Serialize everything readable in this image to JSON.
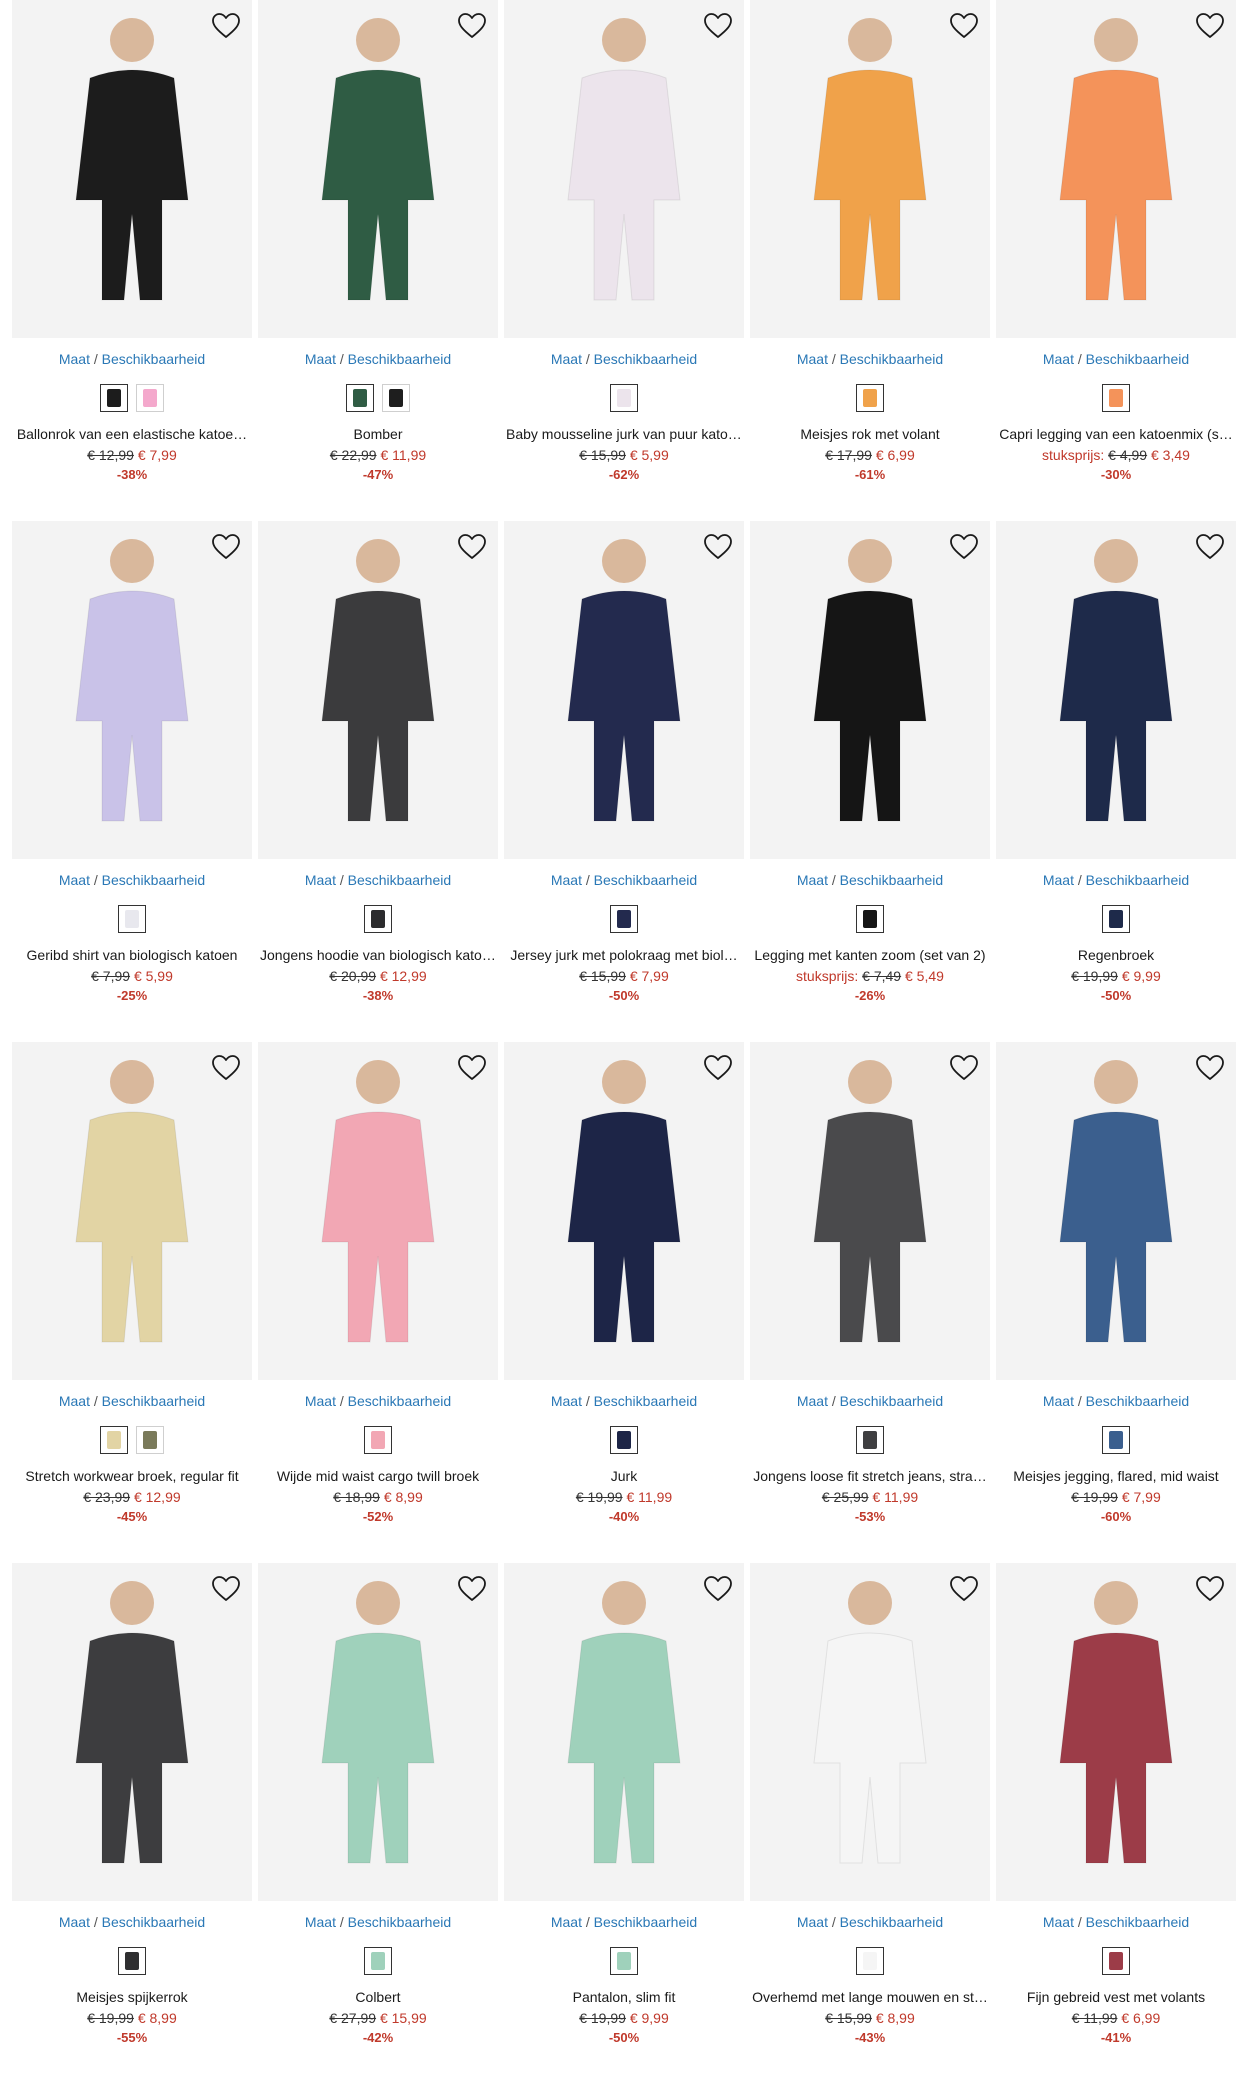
{
  "labels": {
    "size_link_a": "Maat",
    "size_link_sep": " / ",
    "size_link_b": "Beschikbaarheid"
  },
  "colors": {
    "link": "#2a78b6",
    "sale": "#c0392b",
    "image_bg": "#f3f3f3"
  },
  "products": [
    {
      "title": "Ballonrok van een elastische katoe…",
      "old_price": "€ 12,99",
      "new_price": "€ 7,99",
      "discount": "-38%",
      "unit_label": "",
      "main_color": "#1c1c1c",
      "swatches": [
        "#1c1c1c",
        "#f4a8cc"
      ]
    },
    {
      "title": "Bomber",
      "old_price": "€ 22,99",
      "new_price": "€ 11,99",
      "discount": "-47%",
      "unit_label": "",
      "main_color": "#2f5c44",
      "swatches": [
        "#2f5c44",
        "#1e1e1e"
      ]
    },
    {
      "title": "Baby mousseline jurk van puur katoen",
      "old_price": "€ 15,99",
      "new_price": "€ 5,99",
      "discount": "-62%",
      "unit_label": "",
      "main_color": "#ece4ec",
      "swatches": [
        "#ece4ec"
      ]
    },
    {
      "title": "Meisjes rok met volant",
      "old_price": "€ 17,99",
      "new_price": "€ 6,99",
      "discount": "-61%",
      "unit_label": "",
      "main_color": "#f0a24a",
      "swatches": [
        "#f0a24a"
      ]
    },
    {
      "title": "Capri legging van een katoenmix (s…",
      "old_price": "€ 4,99",
      "new_price": "€ 3,49",
      "discount": "-30%",
      "unit_label": "stuksprijs:",
      "main_color": "#f4935a",
      "swatches": [
        "#f4935a"
      ]
    },
    {
      "title": "Geribd shirt van biologisch katoen",
      "old_price": "€ 7,99",
      "new_price": "€ 5,99",
      "discount": "-25%",
      "unit_label": "",
      "main_color": "#c9c2e8",
      "swatches": [
        "#e8e8ee"
      ]
    },
    {
      "title": "Jongens hoodie van biologisch katoen",
      "old_price": "€ 20,99",
      "new_price": "€ 12,99",
      "discount": "-38%",
      "unit_label": "",
      "main_color": "#3b3b3d",
      "swatches": [
        "#2b2b2d"
      ]
    },
    {
      "title": "Jersey jurk met polokraag met biol…",
      "old_price": "€ 15,99",
      "new_price": "€ 7,99",
      "discount": "-50%",
      "unit_label": "",
      "main_color": "#232a4e",
      "swatches": [
        "#232a4e"
      ]
    },
    {
      "title": "Legging met kanten zoom (set van 2)",
      "old_price": "€ 7,49",
      "new_price": "€ 5,49",
      "discount": "-26%",
      "unit_label": "stuksprijs:",
      "main_color": "#151515",
      "swatches": [
        "#151515"
      ]
    },
    {
      "title": "Regenbroek",
      "old_price": "€ 19,99",
      "new_price": "€ 9,99",
      "discount": "-50%",
      "unit_label": "",
      "main_color": "#1e2a4a",
      "swatches": [
        "#1e2a4a"
      ]
    },
    {
      "title": "Stretch workwear broek, regular fit",
      "old_price": "€ 23,99",
      "new_price": "€ 12,99",
      "discount": "-45%",
      "unit_label": "",
      "main_color": "#e2d4a4",
      "swatches": [
        "#e2d4a4",
        "#7a7a5a"
      ]
    },
    {
      "title": "Wijde mid waist cargo twill broek",
      "old_price": "€ 18,99",
      "new_price": "€ 8,99",
      "discount": "-52%",
      "unit_label": "",
      "main_color": "#f2a7b4",
      "swatches": [
        "#f2a7b4"
      ]
    },
    {
      "title": "Jurk",
      "old_price": "€ 19,99",
      "new_price": "€ 11,99",
      "discount": "-40%",
      "unit_label": "",
      "main_color": "#1d2547",
      "swatches": [
        "#1d2547"
      ]
    },
    {
      "title": "Jongens loose fit stretch jeans, stra…",
      "old_price": "€ 25,99",
      "new_price": "€ 11,99",
      "discount": "-53%",
      "unit_label": "",
      "main_color": "#4a4a4c",
      "swatches": [
        "#3e3e40"
      ]
    },
    {
      "title": "Meisjes jegging, flared, mid waist",
      "old_price": "€ 19,99",
      "new_price": "€ 7,99",
      "discount": "-60%",
      "unit_label": "",
      "main_color": "#3b5f8e",
      "swatches": [
        "#3b5f8e"
      ]
    },
    {
      "title": "Meisjes spijkerrok",
      "old_price": "€ 19,99",
      "new_price": "€ 8,99",
      "discount": "-55%",
      "unit_label": "",
      "main_color": "#3d3d3f",
      "swatches": [
        "#2e2e30"
      ]
    },
    {
      "title": "Colbert",
      "old_price": "€ 27,99",
      "new_price": "€ 15,99",
      "discount": "-42%",
      "unit_label": "",
      "main_color": "#9fd1bb",
      "swatches": [
        "#9fd1bb"
      ]
    },
    {
      "title": "Pantalon, slim fit",
      "old_price": "€ 19,99",
      "new_price": "€ 9,99",
      "discount": "-50%",
      "unit_label": "",
      "main_color": "#9fd1bb",
      "swatches": [
        "#9fd1bb"
      ]
    },
    {
      "title": "Overhemd met lange mouwen en st…",
      "old_price": "€ 15,99",
      "new_price": "€ 8,99",
      "discount": "-43%",
      "unit_label": "",
      "main_color": "#f5f5f5",
      "swatches": [
        "#f5f5f5"
      ]
    },
    {
      "title": "Fijn gebreid vest met volants",
      "old_price": "€ 11,99",
      "new_price": "€ 6,99",
      "discount": "-41%",
      "unit_label": "",
      "main_color": "#9c3c48",
      "swatches": [
        "#9c3c48"
      ]
    }
  ]
}
